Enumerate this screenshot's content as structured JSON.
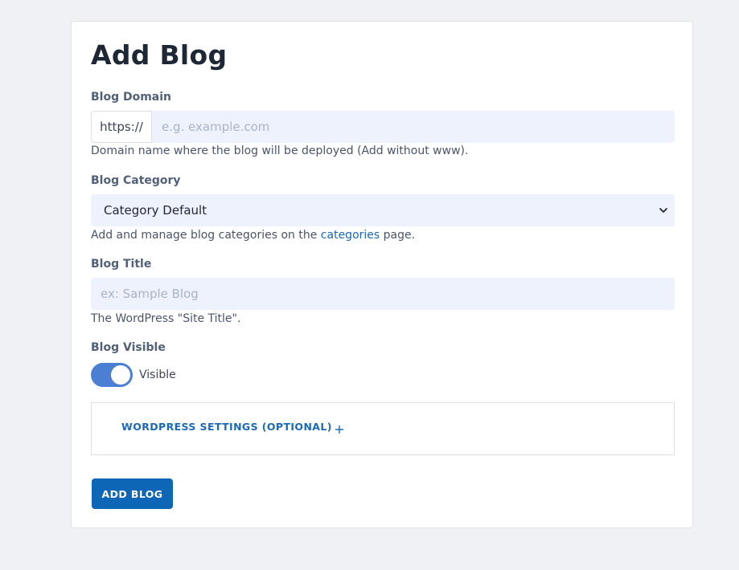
{
  "page": {
    "title": "Add Blog"
  },
  "domain": {
    "label": "Blog Domain",
    "prefix": "https://",
    "placeholder": "e.g. example.com",
    "value": "",
    "help": "Domain name where the blog will be deployed (Add without www)."
  },
  "category": {
    "label": "Blog Category",
    "selected": "Category Default",
    "help_prefix": "Add and manage blog categories on the ",
    "help_link": "categories",
    "help_suffix": " page."
  },
  "blog_title": {
    "label": "Blog Title",
    "placeholder": "ex: Sample Blog",
    "value": "",
    "help": "The WordPress \"Site Title\"."
  },
  "visibility": {
    "label": "Blog Visible",
    "toggle_label": "Visible",
    "on": true
  },
  "wordpress_settings": {
    "title": "WORDPRESS SETTINGS (OPTIONAL)",
    "icon": "plus-icon"
  },
  "actions": {
    "submit_label": "ADD BLOG"
  },
  "colors": {
    "accent": "#0e66b6",
    "link": "#1a69b8",
    "toggle_on": "#4a7fd4",
    "input_bg": "#edf2fc",
    "page_bg": "#f0f1f5"
  }
}
